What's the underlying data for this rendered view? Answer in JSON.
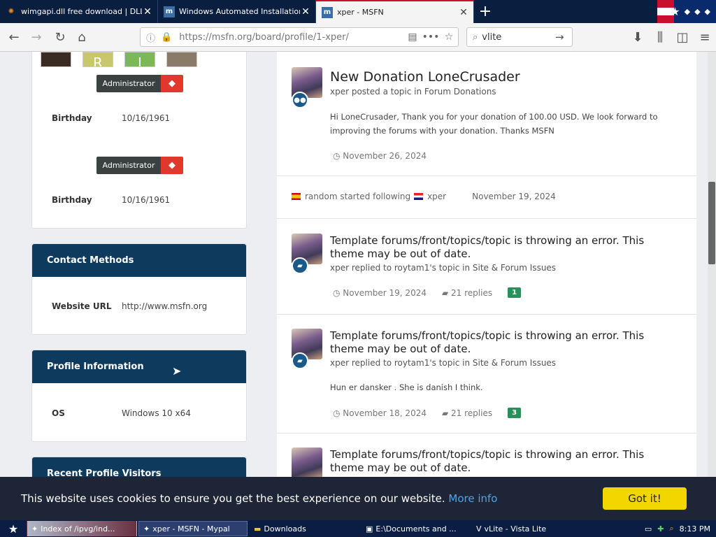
{
  "browser": {
    "tabs": [
      {
        "title": "wimgapi.dll free download | DLL-fil",
        "icon": "gear-icon",
        "active": false
      },
      {
        "title": "Windows Automated Installation K",
        "icon": "msfn-icon",
        "active": false
      },
      {
        "title": "xper - MSFN",
        "icon": "msfn-icon",
        "active": true
      }
    ],
    "url": "https://msfn.org/board/profile/1-xper/",
    "search_value": "vlite"
  },
  "profile": {
    "badges": [
      {
        "label": "Administrator"
      },
      {
        "label": "Administrator"
      }
    ],
    "birthday_rows": [
      {
        "label": "Birthday",
        "value": "10/16/1961"
      },
      {
        "label": "Birthday",
        "value": "10/16/1961"
      }
    ],
    "avatar_letters": [
      "R",
      "I"
    ],
    "contact": {
      "title": "Contact Methods",
      "rows": [
        {
          "label": "Website URL",
          "value": "http://www.msfn.org"
        }
      ]
    },
    "info": {
      "title": "Profile Information",
      "rows": [
        {
          "label": "OS",
          "value": "Windows 10 x64"
        }
      ]
    },
    "visitors_title": "Recent Profile Visitors"
  },
  "feed": {
    "donation": {
      "title": "New Donation LoneCrusader",
      "sub": "xper posted a topic in Forum Donations",
      "body": "Hi LoneCrusader, Thank you for your donation of 100.00 USD. We look forward to improving the forums with your donation. Thanks MSFN",
      "date": "November 26, 2024"
    },
    "follow": {
      "text": "random started following",
      "target": "xper",
      "date": "November 19, 2024"
    },
    "posts": [
      {
        "title": "Template forums/front/topics/topic is throwing an error. This theme may be out of date.",
        "sub": "xper replied to roytam1's topic in Site & Forum Issues",
        "body": "",
        "date": "November 19, 2024",
        "replies": "21 replies",
        "count": "1"
      },
      {
        "title": "Template forums/front/topics/topic is throwing an error. This theme may be out of date.",
        "sub": "xper replied to roytam1's topic in Site & Forum Issues",
        "body": "Hun er dansker . She is danish I think.",
        "date": "November 18, 2024",
        "replies": "21 replies",
        "count": "3"
      },
      {
        "title": "Template forums/front/topics/topic is throwing an error. This theme may be out of date.",
        "sub": "",
        "body": "",
        "date": "",
        "replies": "",
        "count": ""
      }
    ]
  },
  "cookie": {
    "text": "This website uses cookies to ensure you get the best experience on our website.",
    "link": "More info",
    "button": "Got it!"
  },
  "taskbar": {
    "items": [
      {
        "label": "Index of /ipvg/ind...",
        "active": false
      },
      {
        "label": "xper - MSFN - Mypal",
        "active": true
      },
      {
        "label": "Downloads",
        "active": false
      },
      {
        "label": "E:\\Documents and ...",
        "active": false
      },
      {
        "label": "vLite - Vista Lite",
        "active": false
      }
    ],
    "clock": "8:13 PM"
  },
  "colors": {
    "tabbar": "#0a1e3f",
    "card_header": "#0e3a5e",
    "cookie_bar": "#1d2536",
    "cookie_button": "#f1d600",
    "count_badge": "#2b8f5c",
    "admin_badge_icon": "#e0382d"
  }
}
